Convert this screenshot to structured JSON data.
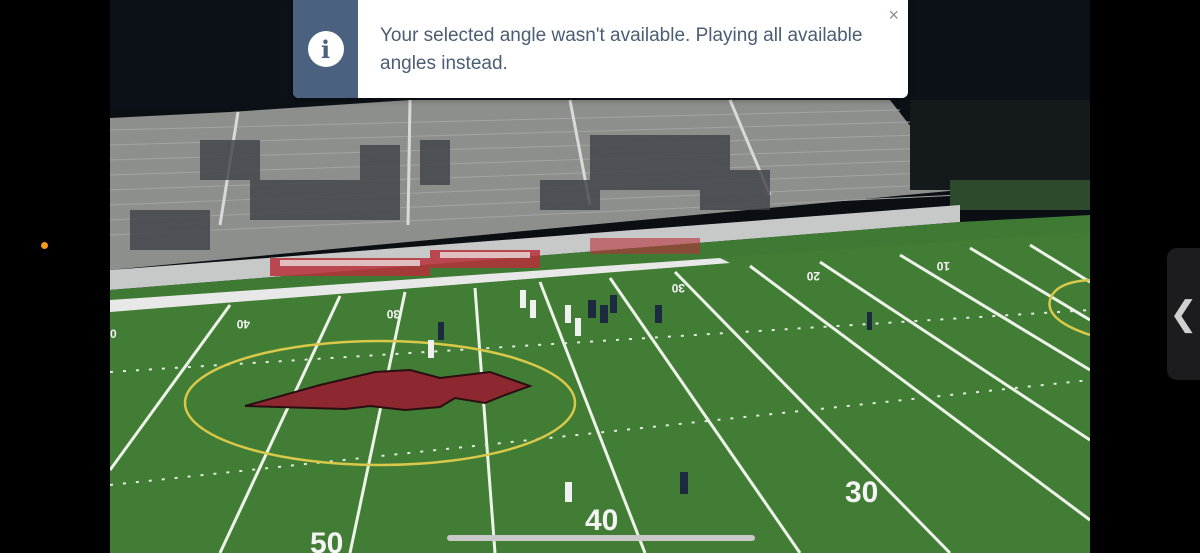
{
  "notification": {
    "icon": "info-icon",
    "icon_glyph": "i",
    "message": "Your selected angle wasn't available. Playing all available angles instead.",
    "close_glyph": "×"
  },
  "video": {
    "field_numbers": {
      "near_left": "50",
      "near_mid": "40",
      "near_right": "30",
      "far_left_edge": "0",
      "far_1": "40",
      "far_2": "30",
      "far_3": "30",
      "far_4": "20",
      "far_5": "10"
    }
  },
  "side_panel": {
    "handle_glyph": "❮"
  },
  "colors": {
    "toast_accent": "#4a6180",
    "toast_text": "#4b5d73",
    "field_green": "#3f7a34",
    "logo_red": "#8e2830",
    "status_dot": "#f39a1e"
  }
}
